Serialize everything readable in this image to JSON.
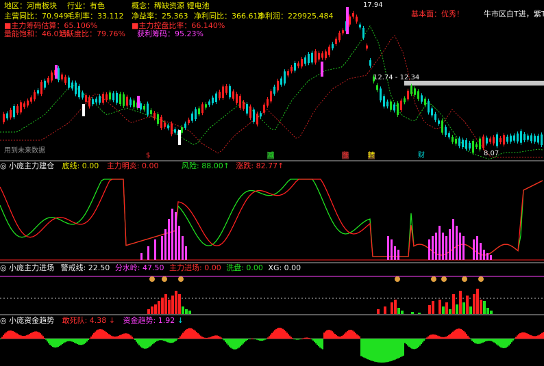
{
  "info": {
    "region": "地区：河南板块",
    "industry": "行业：有色",
    "concept": "概念：稀缺资源 锂电池",
    "main_business_yoy": "主营同比：70.949",
    "gross_margin": "毛利率：33.112",
    "net_margin": "净益率：25.363",
    "net_profit_yoy": "净利同比：366.618",
    "net_profit": "净利润：229925.484",
    "fundamental": "基本面：优秀！",
    "top_right": "牛市区白T进，紫T出",
    "main_chips": "主力筹码估算：65.106%",
    "main_control": "主力控盘比率：66.140%",
    "capacity_saturation": "量能饱和：46.01%",
    "active_chip": "活跃度比：79.76%",
    "profit_chips": "获利筹码：95.23%"
  },
  "main_chart": {
    "high_label": "17.94",
    "low_label": "8.07",
    "range_label": "12.74 - 12.34",
    "future_data": "用到未来数据",
    "signal_marks": [
      "$",
      "减",
      "涨",
      "转",
      "财"
    ]
  },
  "panel1": {
    "title": "小庞主力建仓",
    "base_line": "底线: 0.00",
    "main_build": "主力明炎: 0.00",
    "risk": "风险: 88.00↑",
    "gain": "涨跌: 82.77↑"
  },
  "panel2": {
    "title": "小庞主力进场",
    "warn_line": "警戒线: 22.50",
    "water_line": "分水岭: 47.50",
    "main_entry": "主力进场: 0.00",
    "wash": "洗盘: 0.00",
    "xg": "XG: 0.00"
  },
  "panel3": {
    "title": "小庞资金趋势",
    "dead_team": "敢死队: 4.38",
    "fund_trend": "资金趋势: 1.92"
  },
  "colors": {
    "up": "#ff2020",
    "down": "#00e0e0",
    "green": "#20e020",
    "magenta": "#ff40ff",
    "yellow": "#e8e800"
  }
}
